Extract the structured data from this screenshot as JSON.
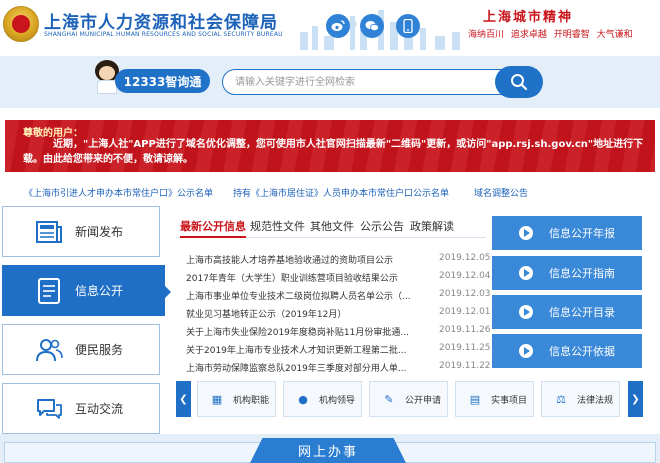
{
  "header": {
    "title": "上海市人力资源和社会保障局",
    "subtitle": "SHANGHAI MUNICIPAL HUMAN RESOURCES AND SOCIAL SECURITY BUREAU",
    "social_icons": [
      "weibo-icon",
      "wechat-icon",
      "mobile-app-icon"
    ],
    "city_spirit_title": "上海城市精神",
    "city_spirit_words": "海纳百川 追求卓越 开明睿智 大气谦和"
  },
  "search": {
    "hotline_label": "12333智询通",
    "placeholder": "请输入关键字进行全网检索"
  },
  "notice": {
    "heading": "尊敬的用户：",
    "body": "近期，\"上海人社\"APP进行了域名优化调整，您可使用市人社官网扫描最新\"二维码\"更新，或访问\"app.rsj.sh.gov.cn\"地址进行下载。由此给您带来的不便，敬请谅解。"
  },
  "marquee": [
    "《上海市引进人才申办本市常住户口》公示名单",
    "持有《上海市居住证》人员申办本市常住户口公示名单",
    "域名调整公告"
  ],
  "side_nav": [
    {
      "label": "新闻发布",
      "icon": "newspaper-icon"
    },
    {
      "label": "信息公开",
      "icon": "document-icon"
    },
    {
      "label": "便民服务",
      "icon": "people-icon"
    },
    {
      "label": "互动交流",
      "icon": "chat-icon"
    }
  ],
  "tabs": [
    "最新公开信息",
    "规范性文件",
    "其他文件",
    "公示公告",
    "政策解读"
  ],
  "news": [
    {
      "title": "上海市高技能人才培养基地验收通过的资助项目公示",
      "date": "2019.12.05"
    },
    {
      "title": "2017年青年（大学生）职业训练营项目验收结果公示",
      "date": "2019.12.04"
    },
    {
      "title": "上海市事业单位专业技术二级岗位拟聘人员名单公示（...",
      "date": "2019.12.03"
    },
    {
      "title": "就业见习基地转正公示（2019年12月）",
      "date": "2019.12.01"
    },
    {
      "title": "关于上海市失业保险2019年度稳岗补贴11月份审批通...",
      "date": "2019.11.26"
    },
    {
      "title": "关于2019年上海市专业技术人才知识更新工程第二批...",
      "date": "2019.11.25"
    },
    {
      "title": "上海市劳动保障监察总队2019年三季度对部分用人单...",
      "date": "2019.11.22"
    }
  ],
  "info_buttons": [
    "信息公开年报",
    "信息公开指南",
    "信息公开目录",
    "信息公开依据"
  ],
  "quick_links": [
    {
      "label": "机构职能",
      "icon": "org-icon"
    },
    {
      "label": "机构领导",
      "icon": "leader-icon"
    },
    {
      "label": "公开申请",
      "icon": "apply-icon"
    },
    {
      "label": "实事项目",
      "icon": "project-icon"
    },
    {
      "label": "法律法规",
      "icon": "law-icon"
    }
  ],
  "online": {
    "label": "网上办事"
  },
  "colors": {
    "brand_blue": "#1e6fc5",
    "notice_red": "#c8141c",
    "accent_red": "#c9141b"
  }
}
